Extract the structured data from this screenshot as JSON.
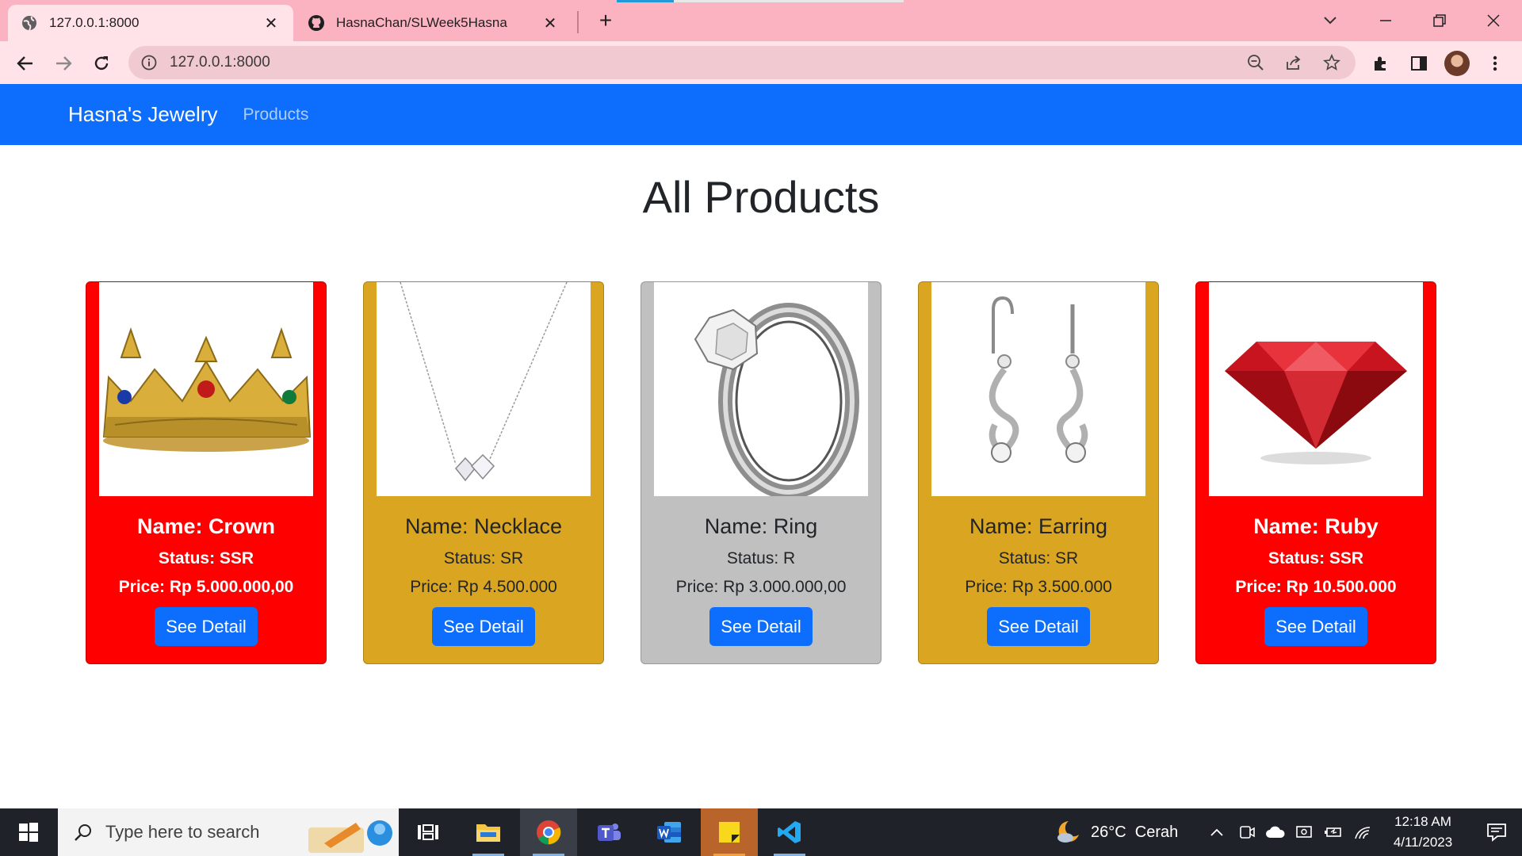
{
  "browser": {
    "tabs": [
      {
        "title": "127.0.0.1:8000",
        "favicon": "globe-icon"
      },
      {
        "title": "HasnaChan/SLWeek5Hasna",
        "favicon": "github-icon"
      }
    ],
    "address": "127.0.0.1:8000"
  },
  "navbar": {
    "brand": "Hasna's Jewelry",
    "link": "Products",
    "color": "#0d6efd"
  },
  "page": {
    "title": "All Products"
  },
  "products": [
    {
      "name": "Name: Crown",
      "status": "Status: SSR",
      "price": "Price: Rp 5.000.000,00",
      "button": "See Detail",
      "card_color": "#ff0000",
      "image": "crown"
    },
    {
      "name": "Name: Necklace",
      "status": "Status: SR",
      "price": "Price: Rp 4.500.000",
      "button": "See Detail",
      "card_color": "#daa520",
      "image": "necklace"
    },
    {
      "name": "Name: Ring",
      "status": "Status: R",
      "price": "Price: Rp 3.000.000,00",
      "button": "See Detail",
      "card_color": "#c0c0c0",
      "image": "ring"
    },
    {
      "name": "Name: Earring",
      "status": "Status: SR",
      "price": "Price: Rp 3.500.000",
      "button": "See Detail",
      "card_color": "#daa520",
      "image": "earring"
    },
    {
      "name": "Name: Ruby",
      "status": "Status: SSR",
      "price": "Price: Rp 10.500.000",
      "button": "See Detail",
      "card_color": "#ff0000",
      "image": "ruby"
    }
  ],
  "taskbar": {
    "search_placeholder": "Type here to search",
    "weather": "26°C  Cerah",
    "time": "12:18 AM",
    "date": "4/11/2023"
  }
}
